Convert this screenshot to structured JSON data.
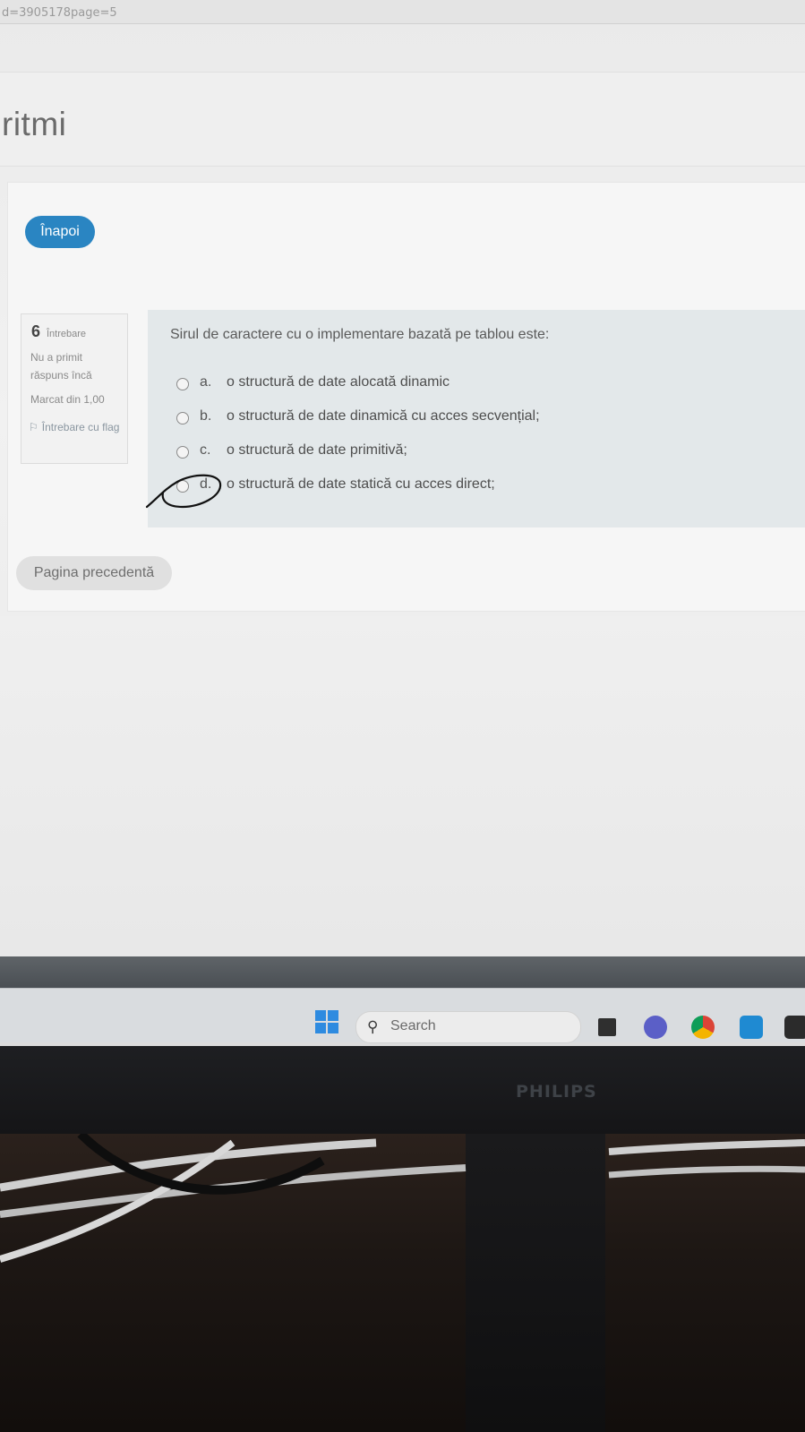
{
  "browser": {
    "url_fragment": "d=3905178page=5"
  },
  "page": {
    "title": "ritmi"
  },
  "nav": {
    "back_label": "Înapoi"
  },
  "question_info": {
    "number": "6",
    "label": "Întrebare",
    "state": "Nu a primit răspuns încă",
    "mark": "Marcat din 1,00",
    "flag_label": "Întrebare cu flag"
  },
  "question": {
    "text": "Sirul de caractere cu o implementare bazată pe tablou este:",
    "options": [
      {
        "letter": "a.",
        "text": "o structură de date alocată dinamic"
      },
      {
        "letter": "b.",
        "text": "o structură de date dinamică cu acces secvențial;"
      },
      {
        "letter": "c.",
        "text": "o structură de date primitivă;"
      },
      {
        "letter": "d.",
        "text": "o structură de date statică cu acces direct;"
      }
    ]
  },
  "footer": {
    "prev_label": "Pagina precedentă"
  },
  "taskbar": {
    "search_placeholder": "Search",
    "apps": [
      "windows-start-icon",
      "file-explorer-icon",
      "chat-icon",
      "chrome-icon",
      "vscode-icon",
      "terminal-icon"
    ]
  },
  "monitor": {
    "brand": "PHILIPS"
  },
  "colors": {
    "accent": "#2a85c2",
    "question_bg": "#e3e8ea",
    "taskbar_bg": "#d9dcdf"
  }
}
